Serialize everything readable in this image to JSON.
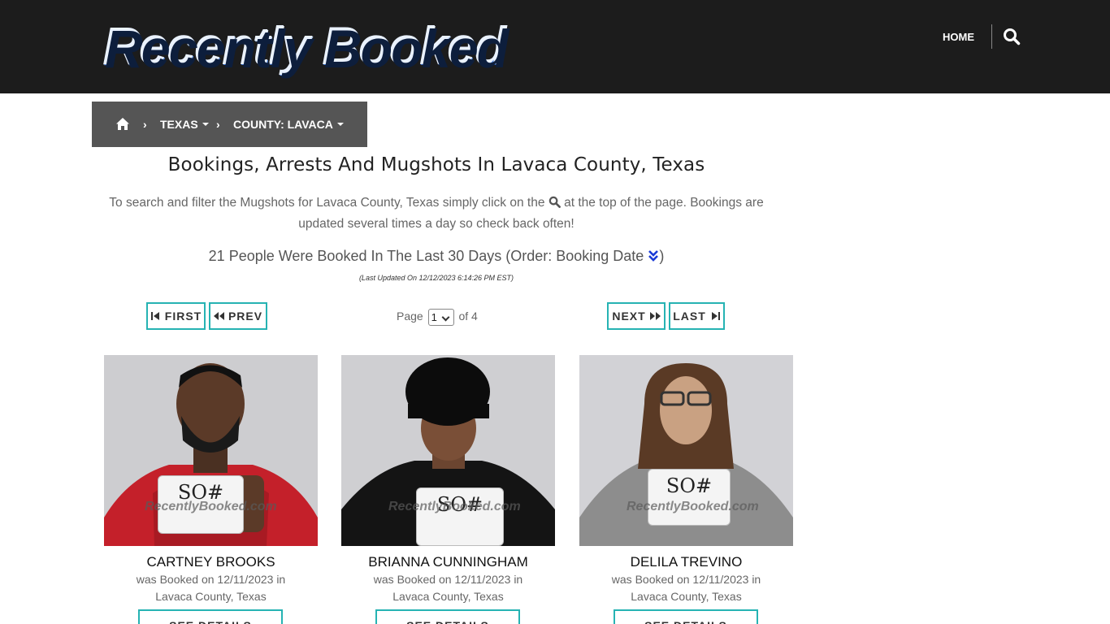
{
  "header": {
    "logo_text": "Recently Booked",
    "nav_home": "HOME",
    "search_icon": "search-icon"
  },
  "breadcrumb": {
    "home_icon": "home-icon",
    "state": "TEXAS",
    "county": "COUNTY: LAVACA"
  },
  "main": {
    "title": "Bookings, Arrests And Mugshots In Lavaca County, Texas",
    "desc_before": "To search and filter the Mugshots for Lavaca County, Texas simply click on the",
    "desc_after": "at the top of the page. Bookings are updated several times a day so check back often!",
    "count_text": "21 People Were Booked In The Last 30 Days (Order: Booking Date",
    "count_close": ")",
    "updated": "(Last Updated On 12/12/2023 6:14:26 PM EST)"
  },
  "pagination": {
    "first": "FIRST",
    "prev": "PREV",
    "next": "NEXT",
    "last": "LAST",
    "page_label": "Page",
    "page_value": "1",
    "of_label": "of 4"
  },
  "bookings": [
    {
      "name": "CARTNEY BROOKS",
      "line1": "was Booked on 12/11/2023 in",
      "line2": "Lavaca County, Texas",
      "button": "SEE DETAILS",
      "watermark": "RecentlyBooked.com",
      "placard": "SO#"
    },
    {
      "name": "BRIANNA CUNNINGHAM",
      "line1": "was Booked on 12/11/2023 in",
      "line2": "Lavaca County, Texas",
      "button": "SEE DETAILS",
      "watermark": "RecentlyBooked.com",
      "placard": "SO#"
    },
    {
      "name": "DELILA TREVINO",
      "line1": "was Booked on 12/11/2023 in",
      "line2": "Lavaca County, Texas",
      "button": "SEE DETAILS",
      "watermark": "RecentlyBooked.com",
      "placard": "SO#"
    }
  ],
  "colors": {
    "header_bg": "#1c1c1c",
    "breadcrumb_bg": "#555555",
    "accent_teal": "#26b3b3",
    "sort_icon": "#1a3bd6"
  }
}
